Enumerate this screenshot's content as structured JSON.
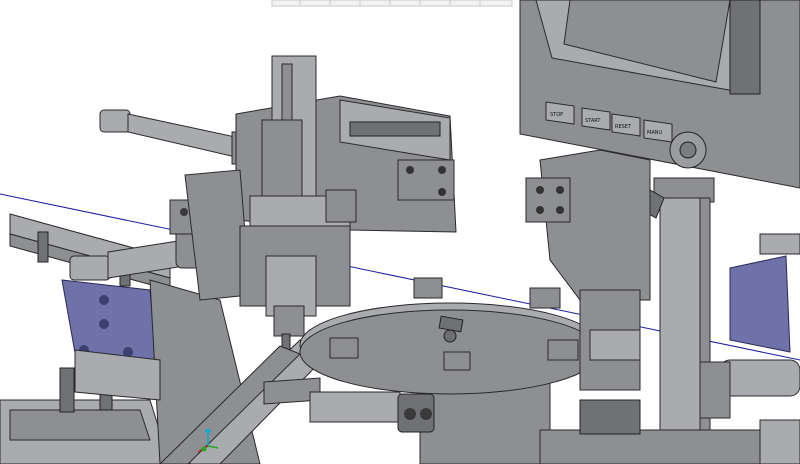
{
  "panel_buttons": [
    {
      "label": "STOP"
    },
    {
      "label": "START"
    },
    {
      "label": "RESET"
    },
    {
      "label": "MANU"
    }
  ],
  "colors": {
    "background": "#ffffff",
    "metal": "#8d8f93",
    "metal_light": "#a9abaf",
    "metal_dark": "#6f7175",
    "accent_blue": "#6f72a8",
    "guide_line": "#1a1aa0"
  },
  "icons": {
    "axis_triad": "xyz-axis-icon"
  }
}
